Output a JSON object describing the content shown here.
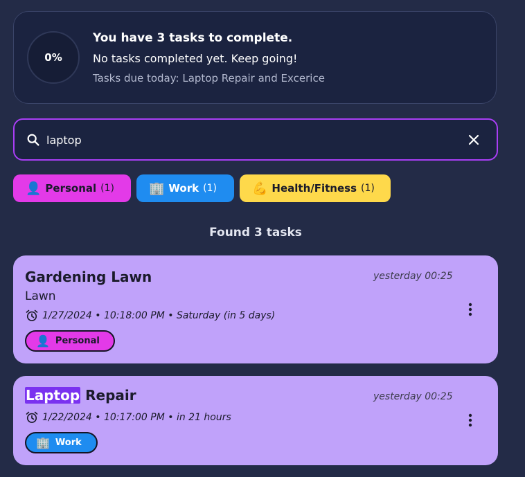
{
  "summary": {
    "progress": "0%",
    "title": "You have 3 tasks to complete.",
    "subtitle": "No tasks completed yet. Keep going!",
    "due_today": "Tasks due today: Laptop Repair and Excerice"
  },
  "search": {
    "value": "laptop",
    "icon": "search-icon",
    "clear_icon": "close-icon"
  },
  "categories": [
    {
      "emoji": "👤",
      "label": "Personal",
      "count": "(1)",
      "color": "#e33ae8"
    },
    {
      "emoji": "🏢",
      "label": "Work",
      "count": "(1)",
      "color": "#1f8cf0"
    },
    {
      "emoji": "💪",
      "label": "Health/Fitness",
      "count": "(1)",
      "color": "#fed94b"
    }
  ],
  "results_text": "Found 3 tasks",
  "tasks": [
    {
      "title": "Gardening Lawn",
      "description": "Lawn",
      "time_ago": "yesterday 00:25",
      "due": "1/27/2024 • 10:18:00 PM • Saturday (in 5 days)",
      "category": {
        "emoji": "👤",
        "label": "Personal"
      }
    },
    {
      "title_highlight": "Laptop",
      "title_rest": " Repair",
      "time_ago": "yesterday 00:25",
      "due": "1/22/2024 • 10:17:00 PM • in 21 hours",
      "category": {
        "emoji": "🏢",
        "label": "Work"
      }
    }
  ],
  "colors": {
    "background": "#232b47",
    "accent": "#a93ef5",
    "card": "#c0a2fa"
  }
}
